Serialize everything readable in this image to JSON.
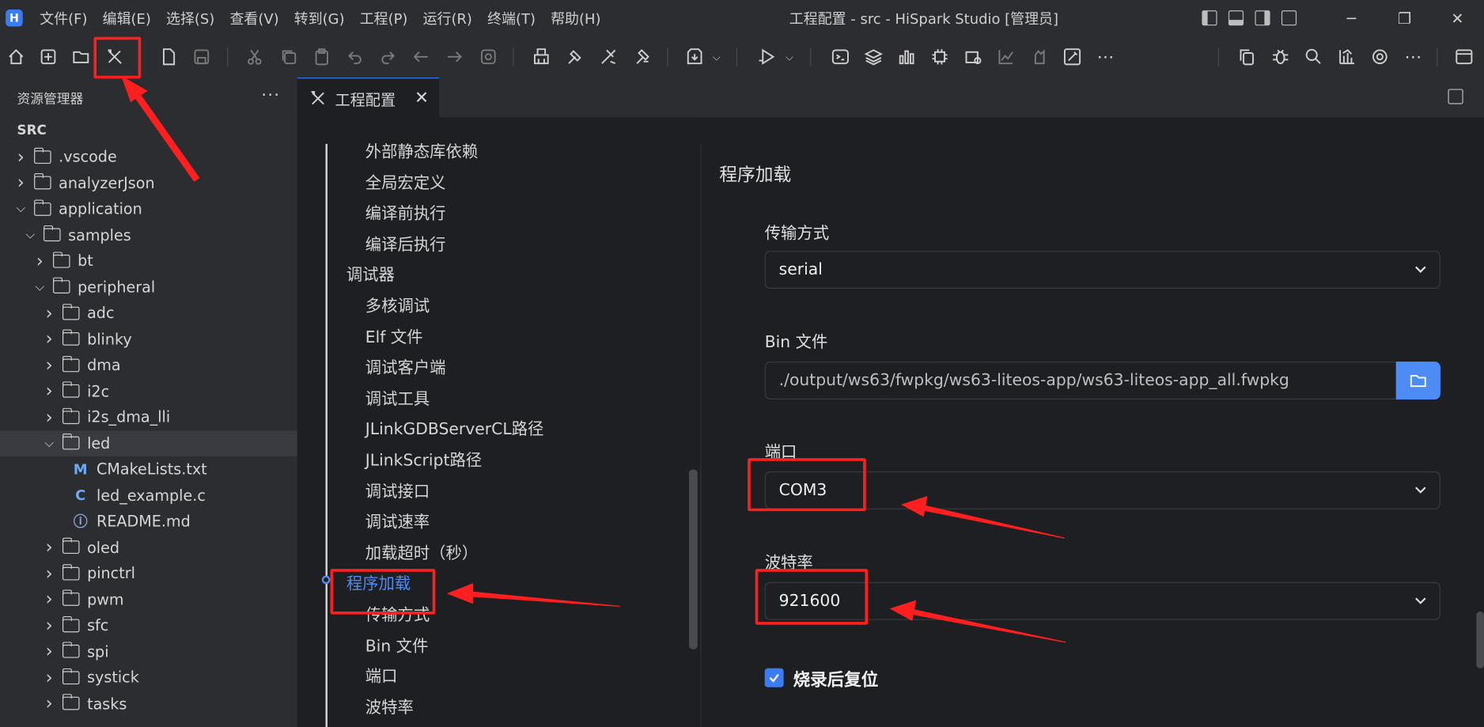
{
  "app": {
    "logo_text": "H",
    "window_title": "工程配置 - src - HiSpark Studio [管理员]"
  },
  "menu": [
    "文件(F)",
    "编辑(E)",
    "选择(S)",
    "查看(V)",
    "转到(G)",
    "工程(P)",
    "运行(R)",
    "终端(T)",
    "帮助(H)"
  ],
  "window_controls": {
    "minimize": "─",
    "restore": "❐",
    "close": "✕"
  },
  "sidebar": {
    "title": "资源管理器",
    "more": "···",
    "root": "SRC",
    "tree": [
      {
        "label": ".vscode",
        "type": "folder",
        "level": 0,
        "expanded": false
      },
      {
        "label": "analyzerJson",
        "type": "folder",
        "level": 0,
        "expanded": false
      },
      {
        "label": "application",
        "type": "folder",
        "level": 0,
        "expanded": true
      },
      {
        "label": "samples",
        "type": "folder",
        "level": 1,
        "expanded": true
      },
      {
        "label": "bt",
        "type": "folder",
        "level": 2,
        "expanded": false
      },
      {
        "label": "peripheral",
        "type": "folder",
        "level": 2,
        "expanded": true
      },
      {
        "label": "adc",
        "type": "folder",
        "level": 3,
        "expanded": false
      },
      {
        "label": "blinky",
        "type": "folder",
        "level": 3,
        "expanded": false
      },
      {
        "label": "dma",
        "type": "folder",
        "level": 3,
        "expanded": false
      },
      {
        "label": "i2c",
        "type": "folder",
        "level": 3,
        "expanded": false
      },
      {
        "label": "i2s_dma_lli",
        "type": "folder",
        "level": 3,
        "expanded": false
      },
      {
        "label": "led",
        "type": "folder",
        "level": 3,
        "expanded": true,
        "selected": true
      },
      {
        "label": "CMakeLists.txt",
        "type": "cmake",
        "level": 4,
        "icon": "M"
      },
      {
        "label": "led_example.c",
        "type": "c",
        "level": 4,
        "icon": "C"
      },
      {
        "label": "README.md",
        "type": "info",
        "level": 4,
        "icon": "ⓘ"
      },
      {
        "label": "oled",
        "type": "folder",
        "level": 3,
        "expanded": false
      },
      {
        "label": "pinctrl",
        "type": "folder",
        "level": 3,
        "expanded": false
      },
      {
        "label": "pwm",
        "type": "folder",
        "level": 3,
        "expanded": false
      },
      {
        "label": "sfc",
        "type": "folder",
        "level": 3,
        "expanded": false
      },
      {
        "label": "spi",
        "type": "folder",
        "level": 3,
        "expanded": false
      },
      {
        "label": "systick",
        "type": "folder",
        "level": 3,
        "expanded": false
      },
      {
        "label": "tasks",
        "type": "folder",
        "level": 3,
        "expanded": false
      }
    ]
  },
  "tab": {
    "label": "工程配置",
    "close": "✕"
  },
  "nav": {
    "items": [
      {
        "label": "外部静态库依赖",
        "indent": 1
      },
      {
        "label": "全局宏定义",
        "indent": 1
      },
      {
        "label": "编译前执行",
        "indent": 1
      },
      {
        "label": "编译后执行",
        "indent": 1
      },
      {
        "label": "调试器",
        "indent": 0
      },
      {
        "label": "多核调试",
        "indent": 1
      },
      {
        "label": "Elf 文件",
        "indent": 1
      },
      {
        "label": "调试客户端",
        "indent": 1
      },
      {
        "label": "调试工具",
        "indent": 1
      },
      {
        "label": "JLinkGDBServerCL路径",
        "indent": 1
      },
      {
        "label": "JLinkScript路径",
        "indent": 1
      },
      {
        "label": "调试接口",
        "indent": 1
      },
      {
        "label": "调试速率",
        "indent": 1
      },
      {
        "label": "加载超时（秒）",
        "indent": 1
      },
      {
        "label": "程序加载",
        "indent": 0,
        "active": true
      },
      {
        "label": "传输方式",
        "indent": 1
      },
      {
        "label": "Bin 文件",
        "indent": 1
      },
      {
        "label": "端口",
        "indent": 1
      },
      {
        "label": "波特率",
        "indent": 1
      }
    ]
  },
  "form": {
    "section_title": "程序加载",
    "transfer_label": "传输方式",
    "transfer_value": "serial",
    "bin_label": "Bin 文件",
    "bin_value": "./output/ws63/fwpkg/ws63-liteos-app/ws63-liteos-app_all.fwpkg",
    "port_label": "端口",
    "port_value": "COM3",
    "baud_label": "波特率",
    "baud_value": "921600",
    "reset_label": "烧录后复位",
    "reset_checked": true
  },
  "colors": {
    "accent": "#4d8cf5",
    "annotation": "#ff1f1f",
    "background": "#1e1f22",
    "panel": "#2b2d30"
  }
}
